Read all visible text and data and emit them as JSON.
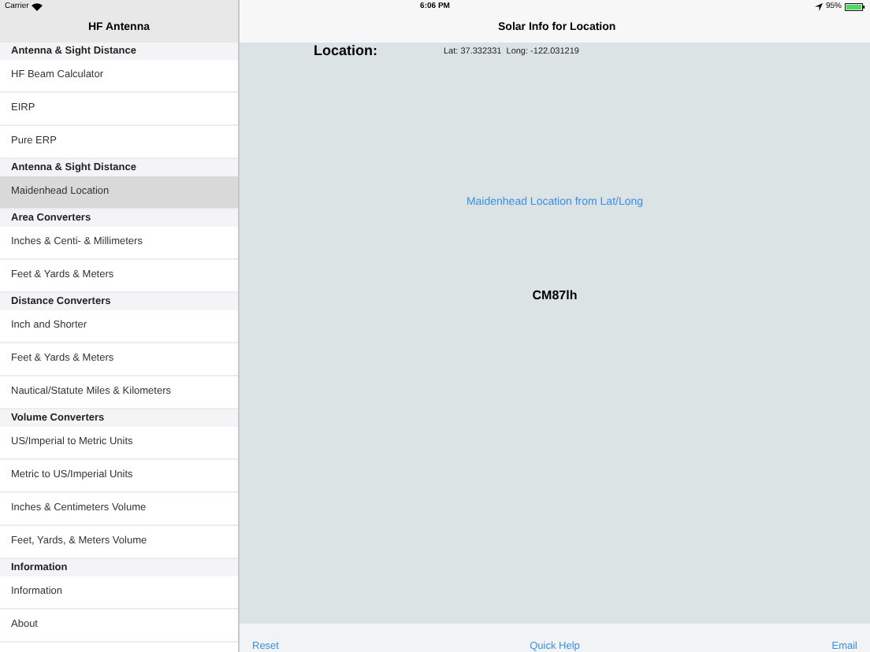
{
  "status_bar": {
    "carrier": "Carrier",
    "time": "6:06 PM",
    "battery": "95%"
  },
  "sidebar": {
    "title": "HF Antenna",
    "sections": [
      {
        "header": "Antenna & Sight Distance",
        "items": [
          {
            "label": "HF Beam Calculator",
            "selected": false
          },
          {
            "label": "EIRP",
            "selected": false
          },
          {
            "label": "Pure ERP",
            "selected": false
          }
        ]
      },
      {
        "header": "Antenna & Sight Distance",
        "items": [
          {
            "label": "Maidenhead Location",
            "selected": true
          }
        ]
      },
      {
        "header": "Area Converters",
        "items": [
          {
            "label": "Inches & Centi- & Millimeters",
            "selected": false
          },
          {
            "label": "Feet & Yards & Meters",
            "selected": false
          }
        ]
      },
      {
        "header": "Distance Converters",
        "items": [
          {
            "label": "Inch and Shorter",
            "selected": false
          },
          {
            "label": "Feet & Yards & Meters",
            "selected": false
          },
          {
            "label": "Nautical/Statute Miles & Kilometers",
            "selected": false
          }
        ]
      },
      {
        "header": "Volume Converters",
        "items": [
          {
            "label": "US/Imperial to Metric Units",
            "selected": false
          },
          {
            "label": "Metric to US/Imperial Units",
            "selected": false
          },
          {
            "label": "Inches & Centimeters Volume",
            "selected": false
          },
          {
            "label": "Feet, Yards, & Meters Volume",
            "selected": false
          }
        ]
      },
      {
        "header": "Information",
        "items": [
          {
            "label": "Information",
            "selected": false
          },
          {
            "label": "About",
            "selected": false
          }
        ]
      }
    ]
  },
  "detail": {
    "title": "Solar Info for Location",
    "location_label": "Location:",
    "coordinates": "Lat: 37.332331  Long: -122.031219",
    "link": "Maidenhead Location from Lat/Long",
    "result": "CM87lh"
  },
  "toolbar": {
    "buttons": [
      "Reset",
      "Quick Help",
      "Email"
    ]
  }
}
